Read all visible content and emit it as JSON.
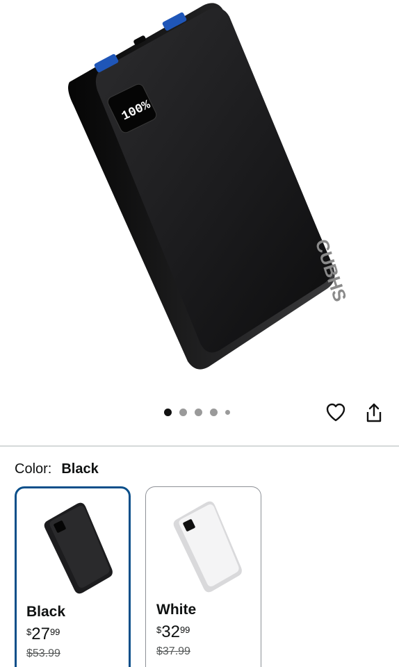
{
  "product": {
    "image_alt": "Power bank",
    "brand_text": "CUBHS",
    "display_text": "100%"
  },
  "gallery": {
    "dot_count": 5,
    "active_index": 0
  },
  "actions": {
    "favorite_icon": "heart-icon",
    "share_icon": "share-icon"
  },
  "color": {
    "label": "Color:",
    "value": "Black"
  },
  "swatches": [
    {
      "name": "Black",
      "currency": "$",
      "price_whole": "27",
      "price_cents": "99",
      "list_price": "$53.99",
      "selected": true
    },
    {
      "name": "White",
      "currency": "$",
      "price_whole": "32",
      "price_cents": "99",
      "list_price": "$37.99",
      "selected": false
    }
  ],
  "colors": {
    "accent_border": "#0a4f8a",
    "active_dot": "#111111",
    "inactive_dot": "#9a9a9a"
  }
}
